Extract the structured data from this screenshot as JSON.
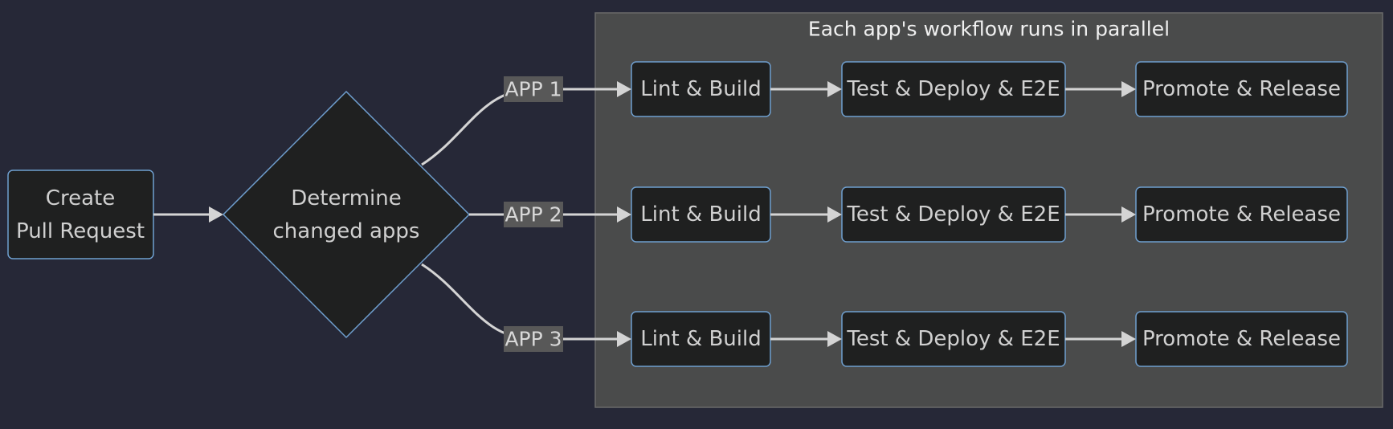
{
  "diagram": {
    "type": "flowchart",
    "direction": "left-to-right",
    "start_node": {
      "id": "create_pr",
      "lines": [
        "Create",
        "Pull Request"
      ],
      "shape": "rounded-rect"
    },
    "decision_node": {
      "id": "determine",
      "lines": [
        "Determine",
        "changed apps"
      ],
      "shape": "diamond"
    },
    "cluster": {
      "title": "Each app's workflow runs in parallel",
      "lanes": [
        {
          "edge_label": "APP 1",
          "steps": [
            "Lint & Build",
            "Test & Deploy & E2E",
            "Promote & Release"
          ]
        },
        {
          "edge_label": "APP 2",
          "steps": [
            "Lint & Build",
            "Test & Deploy & E2E",
            "Promote & Release"
          ]
        },
        {
          "edge_label": "APP 3",
          "steps": [
            "Lint & Build",
            "Test & Deploy & E2E",
            "Promote & Release"
          ]
        }
      ]
    },
    "edges": [
      {
        "from": "create_pr",
        "to": "determine"
      },
      {
        "from": "determine",
        "to": "lane1.step1",
        "label": "APP 1"
      },
      {
        "from": "determine",
        "to": "lane2.step1",
        "label": "APP 2"
      },
      {
        "from": "determine",
        "to": "lane3.step1",
        "label": "APP 3"
      },
      {
        "from": "lane.step1",
        "to": "lane.step2"
      },
      {
        "from": "lane.step2",
        "to": "lane.step3"
      }
    ],
    "colors": {
      "background": "#262837",
      "node_fill": "#1f2020",
      "node_stroke": "#6f9fcf",
      "cluster_fill": "#4a4b4b",
      "edge": "#d4d4d4",
      "text": "#d0d0d0"
    }
  }
}
